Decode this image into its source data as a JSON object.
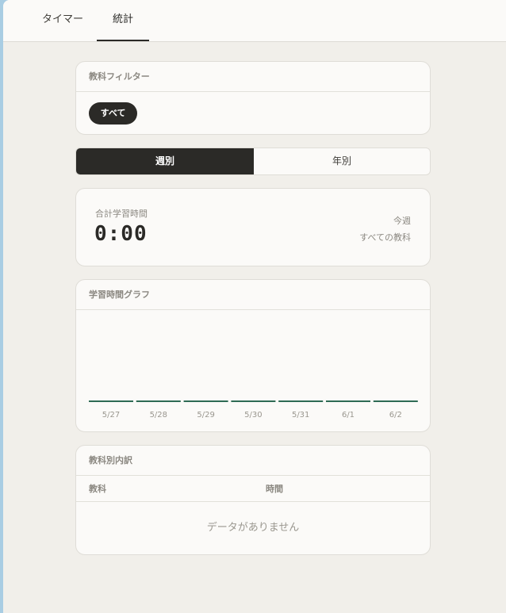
{
  "tabs": [
    {
      "label": "タイマー"
    },
    {
      "label": "統計"
    }
  ],
  "filter": {
    "title": "教科フィルター",
    "chips": [
      {
        "label": "すべて"
      }
    ]
  },
  "period": {
    "options": [
      {
        "label": "週別"
      },
      {
        "label": "年別"
      }
    ]
  },
  "summary": {
    "label": "合計学習時間",
    "value": "0:00",
    "period_label": "今週",
    "subject_label": "すべての教科"
  },
  "chart_card": {
    "title": "学習時間グラフ"
  },
  "chart_data": {
    "type": "bar",
    "categories": [
      "5/27",
      "5/28",
      "5/29",
      "5/30",
      "5/31",
      "6/1",
      "6/2"
    ],
    "values": [
      0,
      0,
      0,
      0,
      0,
      0,
      0
    ],
    "title": "",
    "xlabel": "",
    "ylabel": "",
    "bar_color": "#2e6b55"
  },
  "breakdown": {
    "title": "教科別内訳",
    "columns": [
      "教科",
      "時間"
    ],
    "empty_text": "データがありません"
  }
}
